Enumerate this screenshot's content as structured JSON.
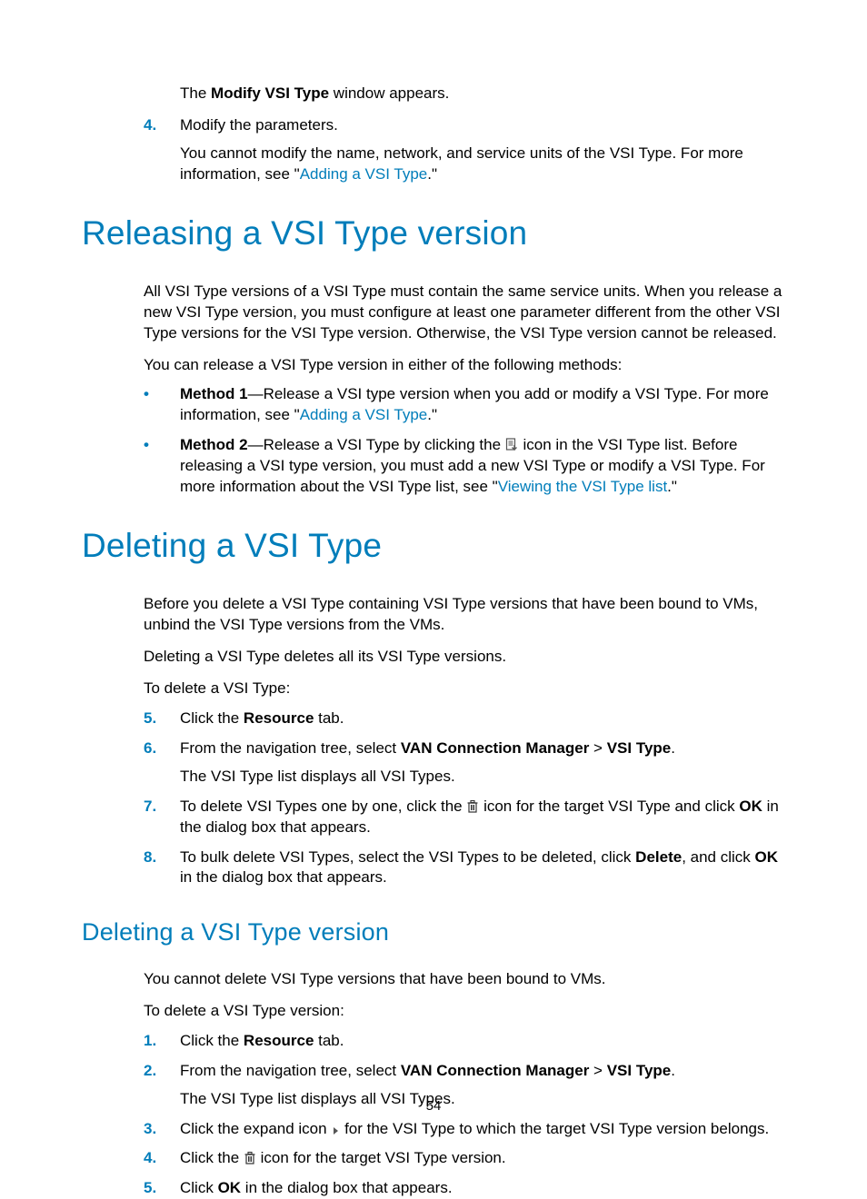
{
  "intro": {
    "line1_a": "The ",
    "line1_b": "Modify VSI Type",
    "line1_c": " window appears.",
    "step4_marker": "4.",
    "step4_a": "Modify the parameters.",
    "step4_info_a": "You cannot modify the name, network, and service units of the VSI Type. For more information, see \"",
    "step4_link": "Adding a VSI Type",
    "step4_info_b": ".\""
  },
  "sec1": {
    "title": "Releasing a VSI Type version",
    "p1": "All VSI Type versions of a VSI Type must contain the same service units. When you release a new VSI Type version, you must configure at least one parameter different from the other VSI Type versions for the VSI Type version. Otherwise, the VSI Type version cannot be released.",
    "p2": "You can release a VSI Type version in either of the following methods:",
    "m1_a": "Method 1",
    "m1_b": "—Release a VSI type version when you add or modify a VSI Type. For more information, see \"",
    "m1_link": "Adding a VSI Type",
    "m1_c": ".\"",
    "m2_a": "Method 2",
    "m2_b": "—Release a VSI Type by clicking the ",
    "m2_c": " icon in the VSI Type list. Before releasing a VSI type version, you must add a new VSI Type or modify a VSI Type. For more information about the VSI Type list, see \"",
    "m2_link": "Viewing the VSI Type list",
    "m2_d": ".\""
  },
  "sec2": {
    "title": "Deleting a VSI Type",
    "p1": "Before you delete a VSI Type containing VSI Type versions that have been bound to VMs, unbind the VSI Type versions from the VMs.",
    "p2": "Deleting a VSI Type deletes all its VSI Type versions.",
    "p3": "To delete a VSI Type:",
    "s5_marker": "5.",
    "s5_a": "Click the ",
    "s5_b": "Resource",
    "s5_c": " tab.",
    "s6_marker": "6.",
    "s6_a": "From the navigation tree, select ",
    "s6_b": "VAN Connection Manager",
    "s6_c": " > ",
    "s6_d": "VSI Type",
    "s6_e": ".",
    "s6_info": "The VSI Type list displays all VSI Types.",
    "s7_marker": "7.",
    "s7_a": "To delete VSI Types one by one, click the ",
    "s7_b": " icon for the target VSI Type and click ",
    "s7_c": "OK",
    "s7_d": " in the dialog box that appears.",
    "s8_marker": "8.",
    "s8_a": "To bulk delete VSI Types, select the VSI Types to be deleted, click ",
    "s8_b": "Delete",
    "s8_c": ", and click ",
    "s8_d": "OK",
    "s8_e": " in the dialog box that appears."
  },
  "sec3": {
    "title": "Deleting a VSI Type version",
    "p1": "You cannot delete VSI Type versions that have been bound to VMs.",
    "p2": "To delete a VSI Type version:",
    "s1_marker": "1.",
    "s1_a": "Click the ",
    "s1_b": "Resource",
    "s1_c": " tab.",
    "s2_marker": "2.",
    "s2_a": "From the navigation tree, select ",
    "s2_b": "VAN Connection Manager",
    "s2_c": " > ",
    "s2_d": "VSI Type",
    "s2_e": ".",
    "s2_info": "The VSI Type list displays all VSI Types.",
    "s3_marker": "3.",
    "s3_a": "Click the expand icon ",
    "s3_b": " for the VSI Type to which the target VSI Type version belongs.",
    "s4_marker": "4.",
    "s4_a": "Click the ",
    "s4_b": " icon for the target VSI Type version.",
    "s5_marker": "5.",
    "s5_a": "Click ",
    "s5_b": "OK",
    "s5_c": " in the dialog box that appears."
  },
  "pagenum": "54"
}
